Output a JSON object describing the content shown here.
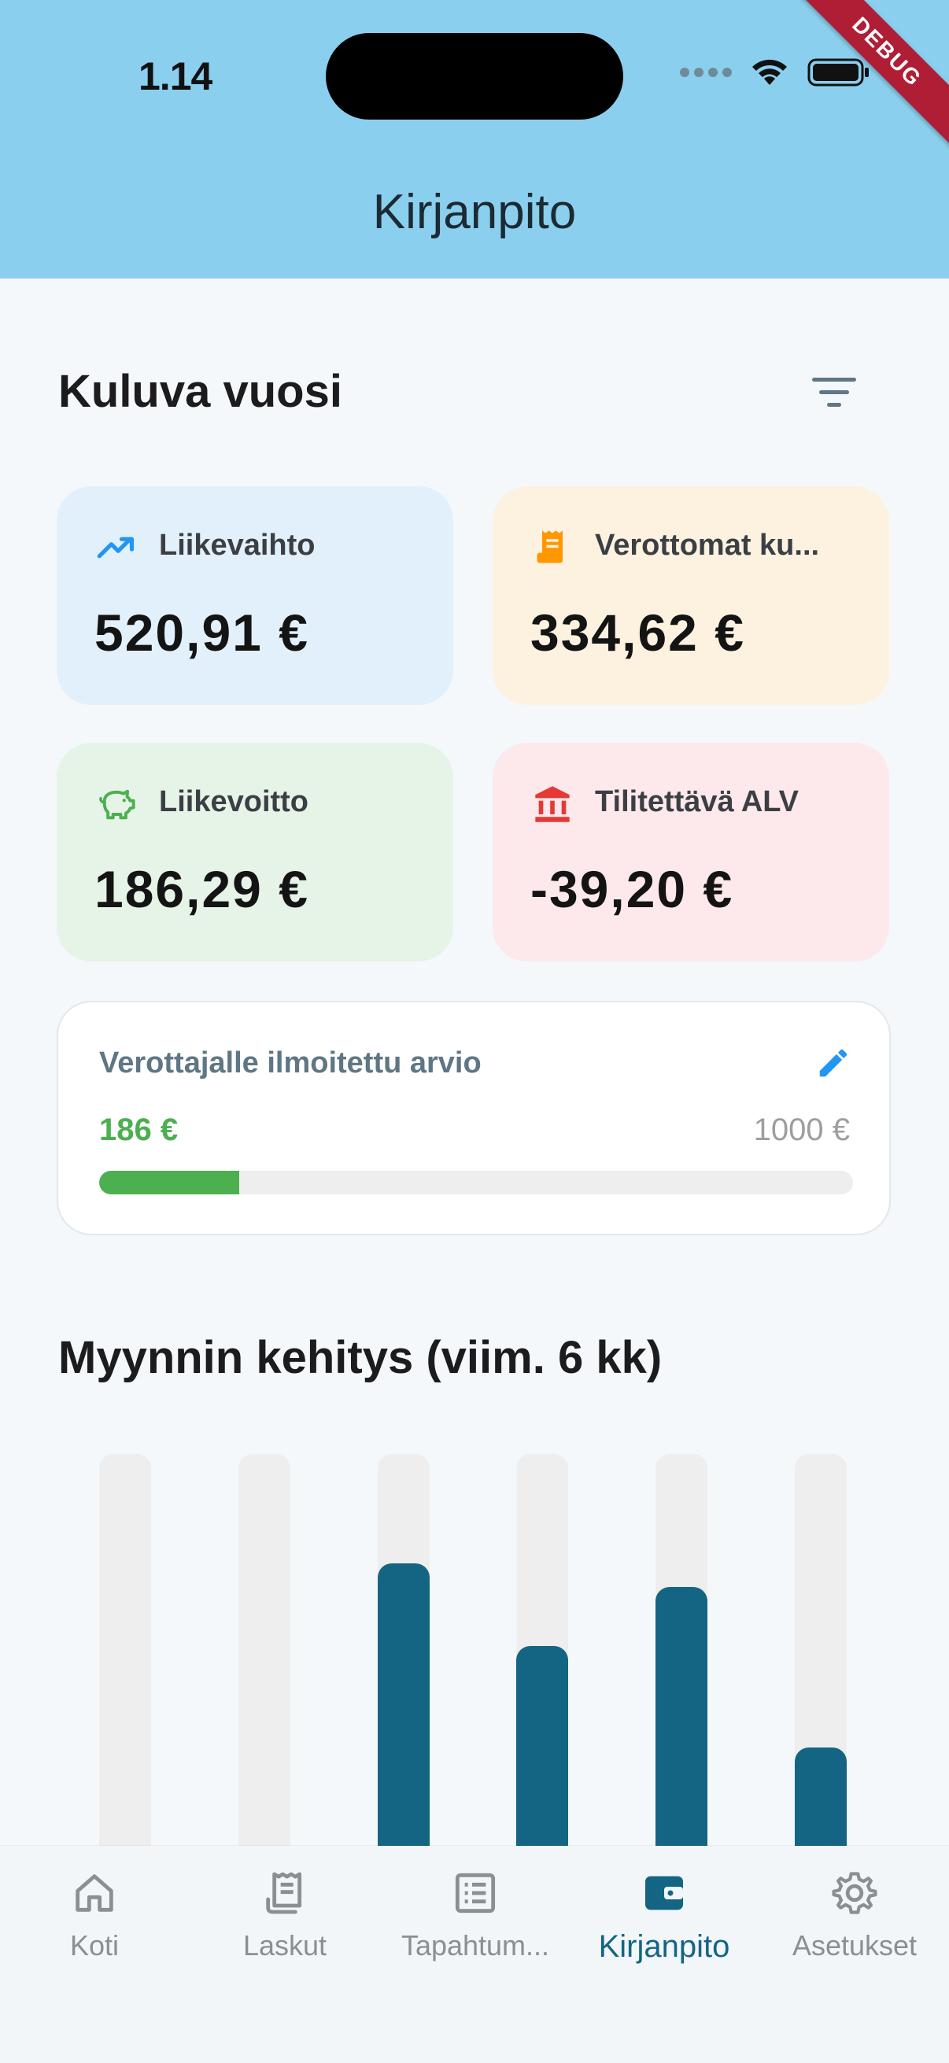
{
  "status_bar": {
    "time": "1.14",
    "debug_label": "DEBUG"
  },
  "app_bar": {
    "title": "Kirjanpito"
  },
  "section": {
    "title": "Kuluva vuosi",
    "filter_icon": "filter-list-icon"
  },
  "cards": [
    {
      "label": "Liikevaihto",
      "value": "520,91 €",
      "icon": "trending-up-icon",
      "accent": "#2196f3",
      "bg": "#e2f0fb"
    },
    {
      "label": "Verottomat ku...",
      "value": "334,62 €",
      "icon": "receipt-icon",
      "accent": "#ff9800",
      "bg": "#fdf2e0"
    },
    {
      "label": "Liikevoitto",
      "value": "186,29 €",
      "icon": "piggy-bank-icon",
      "accent": "#4caf50",
      "bg": "#e6f4e7"
    },
    {
      "label": "Tilitettävä ALV",
      "value": "-39,20 €",
      "icon": "bank-icon",
      "accent": "#e53935",
      "bg": "#fde8eb"
    }
  ],
  "estimate": {
    "title": "Verottajalle ilmoitettu arvio",
    "current": "186 €",
    "target": "1000 €",
    "progress": 0.186,
    "edit_icon": "edit-pencil-icon"
  },
  "chart": {
    "title": "Myynnin kehitys (viim. 6 kk)"
  },
  "chart_data": {
    "type": "bar",
    "categories": [
      "",
      "",
      "",
      "",
      "",
      ""
    ],
    "values": [
      0,
      0,
      0.72,
      0.51,
      0.66,
      0.25
    ],
    "ylim": [
      0,
      1
    ],
    "xlabel": "",
    "ylabel": "",
    "bar_color": "#136583",
    "track_color": "#eeeeee"
  },
  "bottom_nav": {
    "items": [
      {
        "label": "Koti",
        "icon": "home-icon",
        "active": false
      },
      {
        "label": "Laskut",
        "icon": "invoice-icon",
        "active": false
      },
      {
        "label": "Tapahtum...",
        "icon": "list-icon",
        "active": false
      },
      {
        "label": "Kirjanpito",
        "icon": "wallet-icon",
        "active": true
      },
      {
        "label": "Asetukset",
        "icon": "settings-gear-icon",
        "active": false
      }
    ]
  },
  "colors": {
    "app_bar": "#8bcfef",
    "primary": "#136583",
    "background": "#f4f8fb"
  }
}
